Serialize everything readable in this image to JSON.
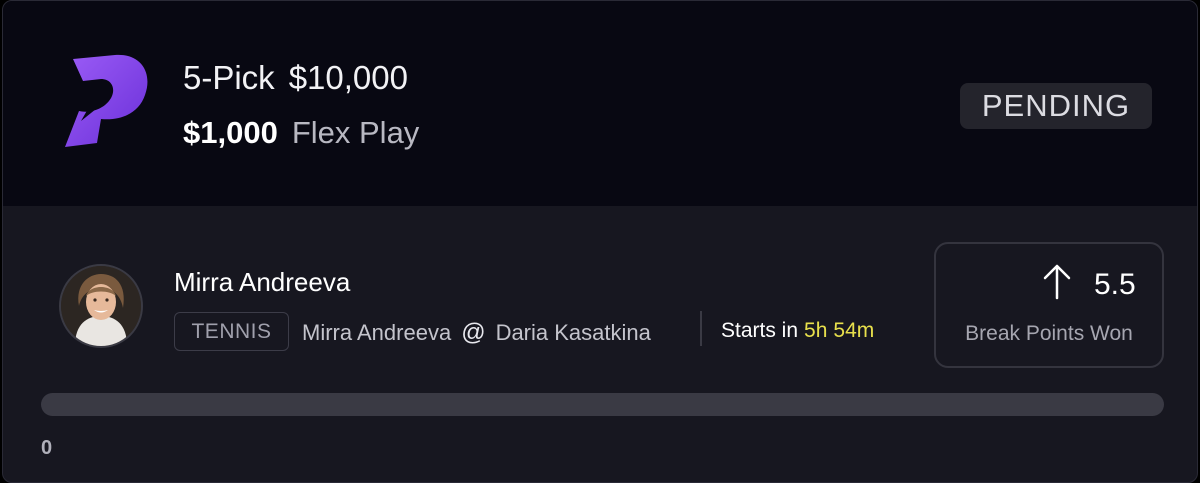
{
  "header": {
    "logo_icon": "prizepicks-logo",
    "pick_count": "5-Pick",
    "payout": "$10,000",
    "entry_amount": "$1,000",
    "play_type": "Flex Play",
    "status": "PENDING"
  },
  "pick": {
    "avatar_icon": "player-photo",
    "player_name": "Mirra Andreeva",
    "sport": "TENNIS",
    "player": "Mirra Andreeva",
    "at": "@",
    "opponent": "Daria Kasatkina",
    "starts_label": "Starts in",
    "starts_hours": "5h",
    "starts_minutes": "54m",
    "direction_icon": "arrow-up-icon",
    "line_value": "5.5",
    "stat_name": "Break Points Won"
  },
  "progress": {
    "current": 0,
    "label": "0"
  },
  "colors": {
    "brand": "#7b3fe4",
    "countdown": "#e8e04c"
  }
}
